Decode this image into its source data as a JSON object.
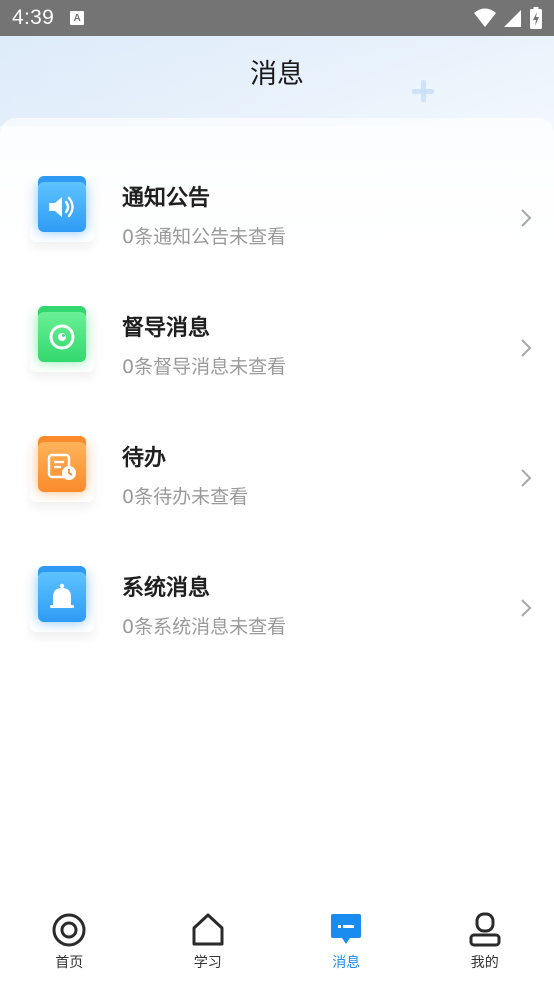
{
  "status_bar": {
    "time": "4:39",
    "notif_icon_letter": "A"
  },
  "header": {
    "title": "消息"
  },
  "messages": [
    {
      "title": "通知公告",
      "subtitle": "0条通知公告未查看",
      "icon": "speaker-icon",
      "color": "#2f9bf5"
    },
    {
      "title": "督导消息",
      "subtitle": "0条督导消息未查看",
      "icon": "eye-target-icon",
      "color": "#33d86e"
    },
    {
      "title": "待办",
      "subtitle": "0条待办未查看",
      "icon": "todo-clock-icon",
      "color": "#fb8b2c"
    },
    {
      "title": "系统消息",
      "subtitle": "0条系统消息未查看",
      "icon": "bell-icon",
      "color": "#2f9bf5"
    }
  ],
  "nav": {
    "items": [
      {
        "label": "首页",
        "icon": "home-target-icon"
      },
      {
        "label": "学习",
        "icon": "house-icon"
      },
      {
        "label": "消息",
        "icon": "message-icon",
        "active": true
      },
      {
        "label": "我的",
        "icon": "profile-icon"
      }
    ],
    "active_color": "#1a8cf0"
  }
}
